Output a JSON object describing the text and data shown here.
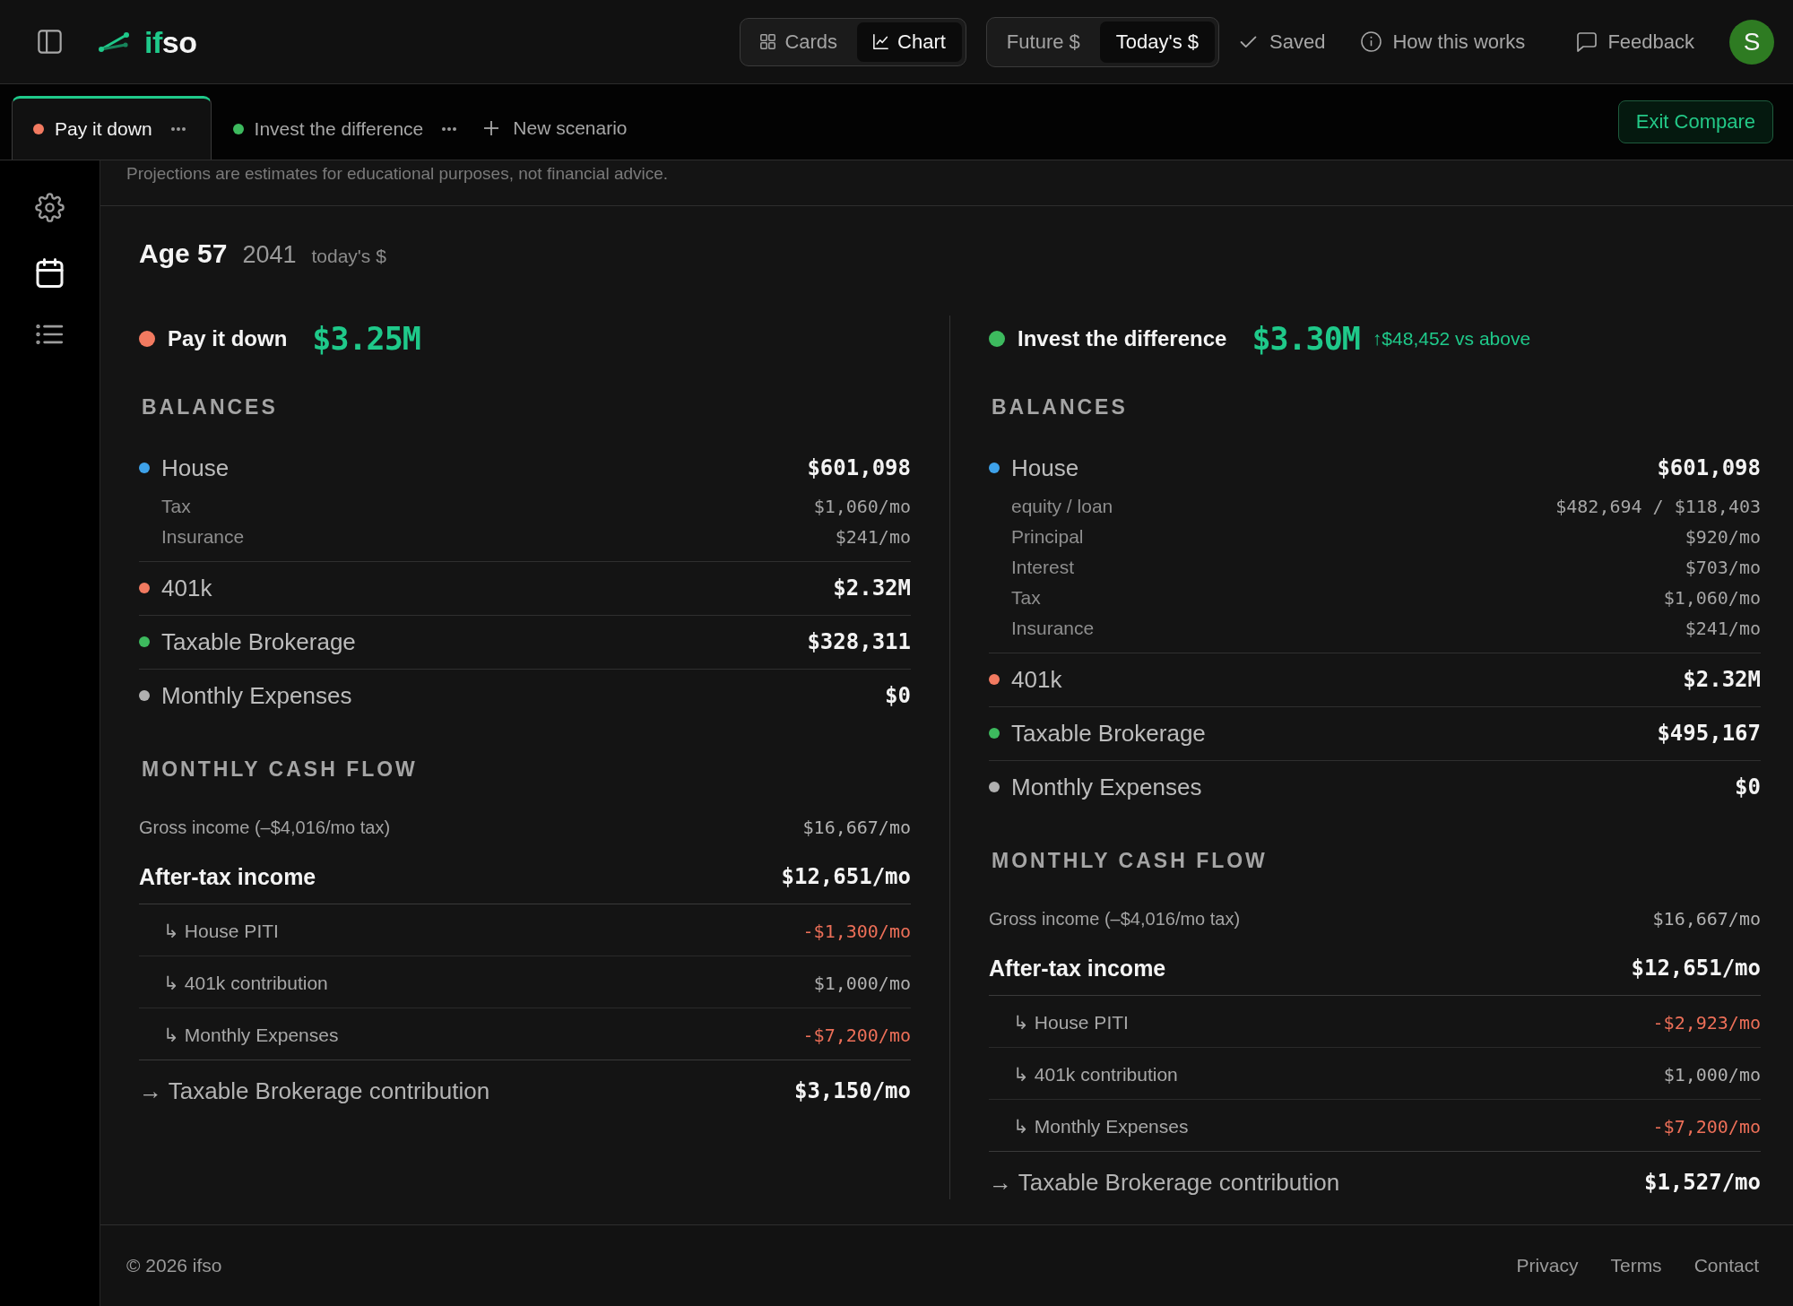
{
  "header": {
    "logo": {
      "accent": "if",
      "text": "so"
    },
    "view_toggle": [
      {
        "label": "Cards",
        "selected": false
      },
      {
        "label": "Chart",
        "selected": true
      }
    ],
    "currency_toggle": [
      {
        "label": "Future $",
        "selected": false
      },
      {
        "label": "Today's $",
        "selected": true
      }
    ],
    "save_status": "Saved",
    "help_link": "How this works",
    "feedback_button": "Feedback",
    "avatar_initial": "S"
  },
  "scenario_tabs": [
    {
      "label": "Pay it down",
      "color": "#f27a60",
      "selected": true
    },
    {
      "label": "Invest the difference",
      "color": "#3dba5e",
      "selected": false
    }
  ],
  "new_scenario_button": "New scenario",
  "exit_compare_button": "Exit Compare",
  "sidebar": {
    "items": [
      {
        "selected": false
      },
      {
        "selected": true
      },
      {
        "selected": false
      }
    ]
  },
  "disclaimer": "Projections are estimates for educational purposes, not financial advice.",
  "snapshot": {
    "age": "Age 57",
    "year": "2041",
    "unit": "today's $"
  },
  "scenarios": [
    {
      "name": "Pay it down",
      "color": "#f27a60",
      "total": "$3.25M",
      "balances_title": "BALANCES",
      "balances": [
        {
          "label": "House",
          "color": "#3ea2ea",
          "value": "$601,098",
          "details": [
            {
              "label": "Tax",
              "value": "$1,060/mo"
            },
            {
              "label": "Insurance",
              "value": "$241/mo"
            }
          ]
        },
        {
          "label": "401k",
          "color": "#f27a60",
          "value": "$2.32M"
        },
        {
          "label": "Taxable Brokerage",
          "color": "#3dba5e",
          "value": "$328,311"
        },
        {
          "label": "Monthly Expenses",
          "color": "#b0b0b0",
          "value": "$0"
        }
      ],
      "cash_flow_title": "MONTHLY CASH FLOW",
      "gross_income": {
        "label": "Gross income (–$4,016/mo tax)",
        "value": "$16,667/mo"
      },
      "after_tax_income": {
        "label": "After-tax income",
        "value": "$12,651/mo"
      },
      "allocations": [
        {
          "label": "↳ House PITI",
          "value": "-$1,300/mo",
          "negative": true
        },
        {
          "label": "↳ 401k contribution",
          "value": "$1,000/mo",
          "negative": false
        },
        {
          "label": "↳ Monthly Expenses",
          "value": "-$7,200/mo",
          "negative": true
        }
      ],
      "remainder": {
        "label": "→ Taxable Brokerage contribution",
        "value": "$3,150/mo"
      }
    },
    {
      "name": "Invest the difference",
      "color": "#3dba5e",
      "total": "$3.30M",
      "delta": "↑$48,452 vs above",
      "balances_title": "BALANCES",
      "balances": [
        {
          "label": "House",
          "color": "#3ea2ea",
          "value": "$601,098",
          "details": [
            {
              "label": "equity / loan",
              "value": "$482,694 / $118,403"
            },
            {
              "label": "Principal",
              "value": "$920/mo"
            },
            {
              "label": "Interest",
              "value": "$703/mo"
            },
            {
              "label": "Tax",
              "value": "$1,060/mo"
            },
            {
              "label": "Insurance",
              "value": "$241/mo"
            }
          ]
        },
        {
          "label": "401k",
          "color": "#f27a60",
          "value": "$2.32M"
        },
        {
          "label": "Taxable Brokerage",
          "color": "#3dba5e",
          "value": "$495,167"
        },
        {
          "label": "Monthly Expenses",
          "color": "#b0b0b0",
          "value": "$0"
        }
      ],
      "cash_flow_title": "MONTHLY CASH FLOW",
      "gross_income": {
        "label": "Gross income (–$4,016/mo tax)",
        "value": "$16,667/mo"
      },
      "after_tax_income": {
        "label": "After-tax income",
        "value": "$12,651/mo"
      },
      "allocations": [
        {
          "label": "↳ House PITI",
          "value": "-$2,923/mo",
          "negative": true
        },
        {
          "label": "↳ 401k contribution",
          "value": "$1,000/mo",
          "negative": false
        },
        {
          "label": "↳ Monthly Expenses",
          "value": "-$7,200/mo",
          "negative": true
        }
      ],
      "remainder": {
        "label": "→ Taxable Brokerage contribution",
        "value": "$1,527/mo"
      }
    }
  ],
  "footer": {
    "copyright": "© 2026 ifso",
    "links": [
      "Privacy",
      "Terms",
      "Contact"
    ]
  }
}
